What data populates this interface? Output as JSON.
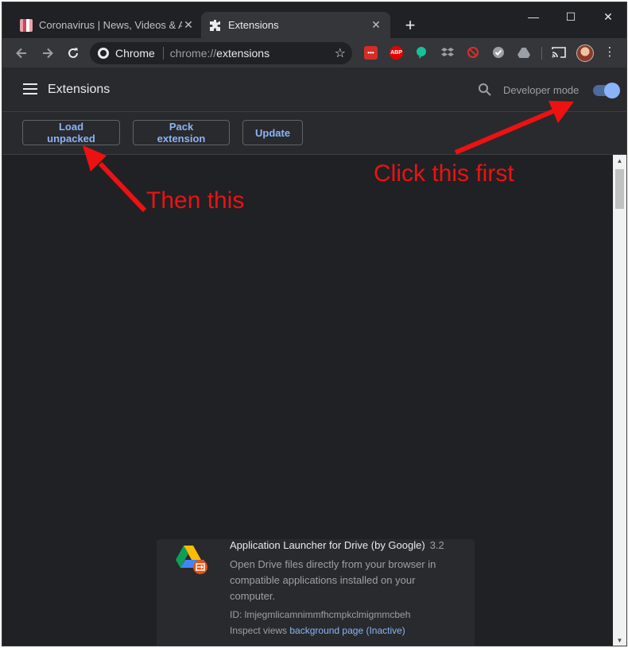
{
  "tabs": [
    {
      "title": "Coronavirus | News, Videos & Art",
      "active": false,
      "close": "✕"
    },
    {
      "title": "Extensions",
      "active": true,
      "close": "✕"
    }
  ],
  "new_tab_label": "+",
  "window_controls": {
    "minimize": "—",
    "maximize": "☐",
    "close": "✕"
  },
  "toolbar": {
    "site_name": "Chrome",
    "url_scheme": "chrome://",
    "url_path": "extensions",
    "extensions": [
      {
        "name": "lastpass-icon",
        "label": "•••",
        "color": "#d32d27"
      },
      {
        "name": "adblock-plus-icon",
        "label": "ABP",
        "color": "#e40000"
      }
    ]
  },
  "header": {
    "title": "Extensions",
    "developer_mode_label": "Developer mode",
    "developer_mode_on": true
  },
  "actions": {
    "load_unpacked": "Load unpacked",
    "pack_extension": "Pack extension",
    "update": "Update"
  },
  "extension_card": {
    "name": "Application Launcher for Drive (by Google)",
    "version": "3.2",
    "description": "Open Drive files directly from your browser in compatible applications installed on your computer.",
    "id_label": "ID: lmjegmlicamnimmfhcmpkclmigmmcbeh",
    "inspect_label": "Inspect views",
    "inspect_link": "background page (Inactive)"
  },
  "annotations": {
    "first": "Click this first",
    "second": "Then this"
  },
  "colors": {
    "accent": "#8ab4f8",
    "annotation": "#ee1111",
    "background": "#202124"
  }
}
